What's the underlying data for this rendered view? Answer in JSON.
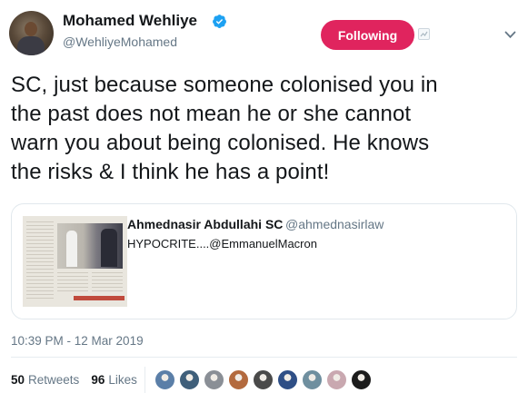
{
  "author": {
    "display_name": "Mohamed Wehliye",
    "handle": "@WehliyeMohamed",
    "verified": true
  },
  "follow_button": {
    "label": "Following",
    "color": "#e0245e"
  },
  "tweet": {
    "text": "SC, just because someone colonised you in\nthe past does not mean he or she cannot\nwarn you about being colonised. He knows\nthe risks & I think he has a point!"
  },
  "quoted_tweet": {
    "author_name": "Ahmednasir Abdullahi SC",
    "author_handle": "@ahmednasirlaw",
    "text": "HYPOCRITE....@EmmanuelMacron"
  },
  "timestamp": "10:39 PM - 12 Mar 2019",
  "stats": {
    "retweets_count": "50",
    "retweets_label": "Retweets",
    "likes_count": "96",
    "likes_label": "Likes"
  },
  "likers": [
    {
      "name": "liker-1",
      "color": "#5b7fa8"
    },
    {
      "name": "liker-2",
      "color": "#3f5f7a"
    },
    {
      "name": "liker-3",
      "color": "#8a8f96"
    },
    {
      "name": "liker-4",
      "color": "#b36a3e"
    },
    {
      "name": "liker-5",
      "color": "#4a4a4a"
    },
    {
      "name": "liker-6",
      "color": "#2f4f86"
    },
    {
      "name": "liker-7",
      "color": "#6f8f9f"
    },
    {
      "name": "liker-8",
      "color": "#c9a8b0"
    },
    {
      "name": "liker-9",
      "color": "#1c1c1c"
    }
  ],
  "colors": {
    "accent": "#1da1f2",
    "text": "#14171a",
    "secondary": "#657786"
  }
}
